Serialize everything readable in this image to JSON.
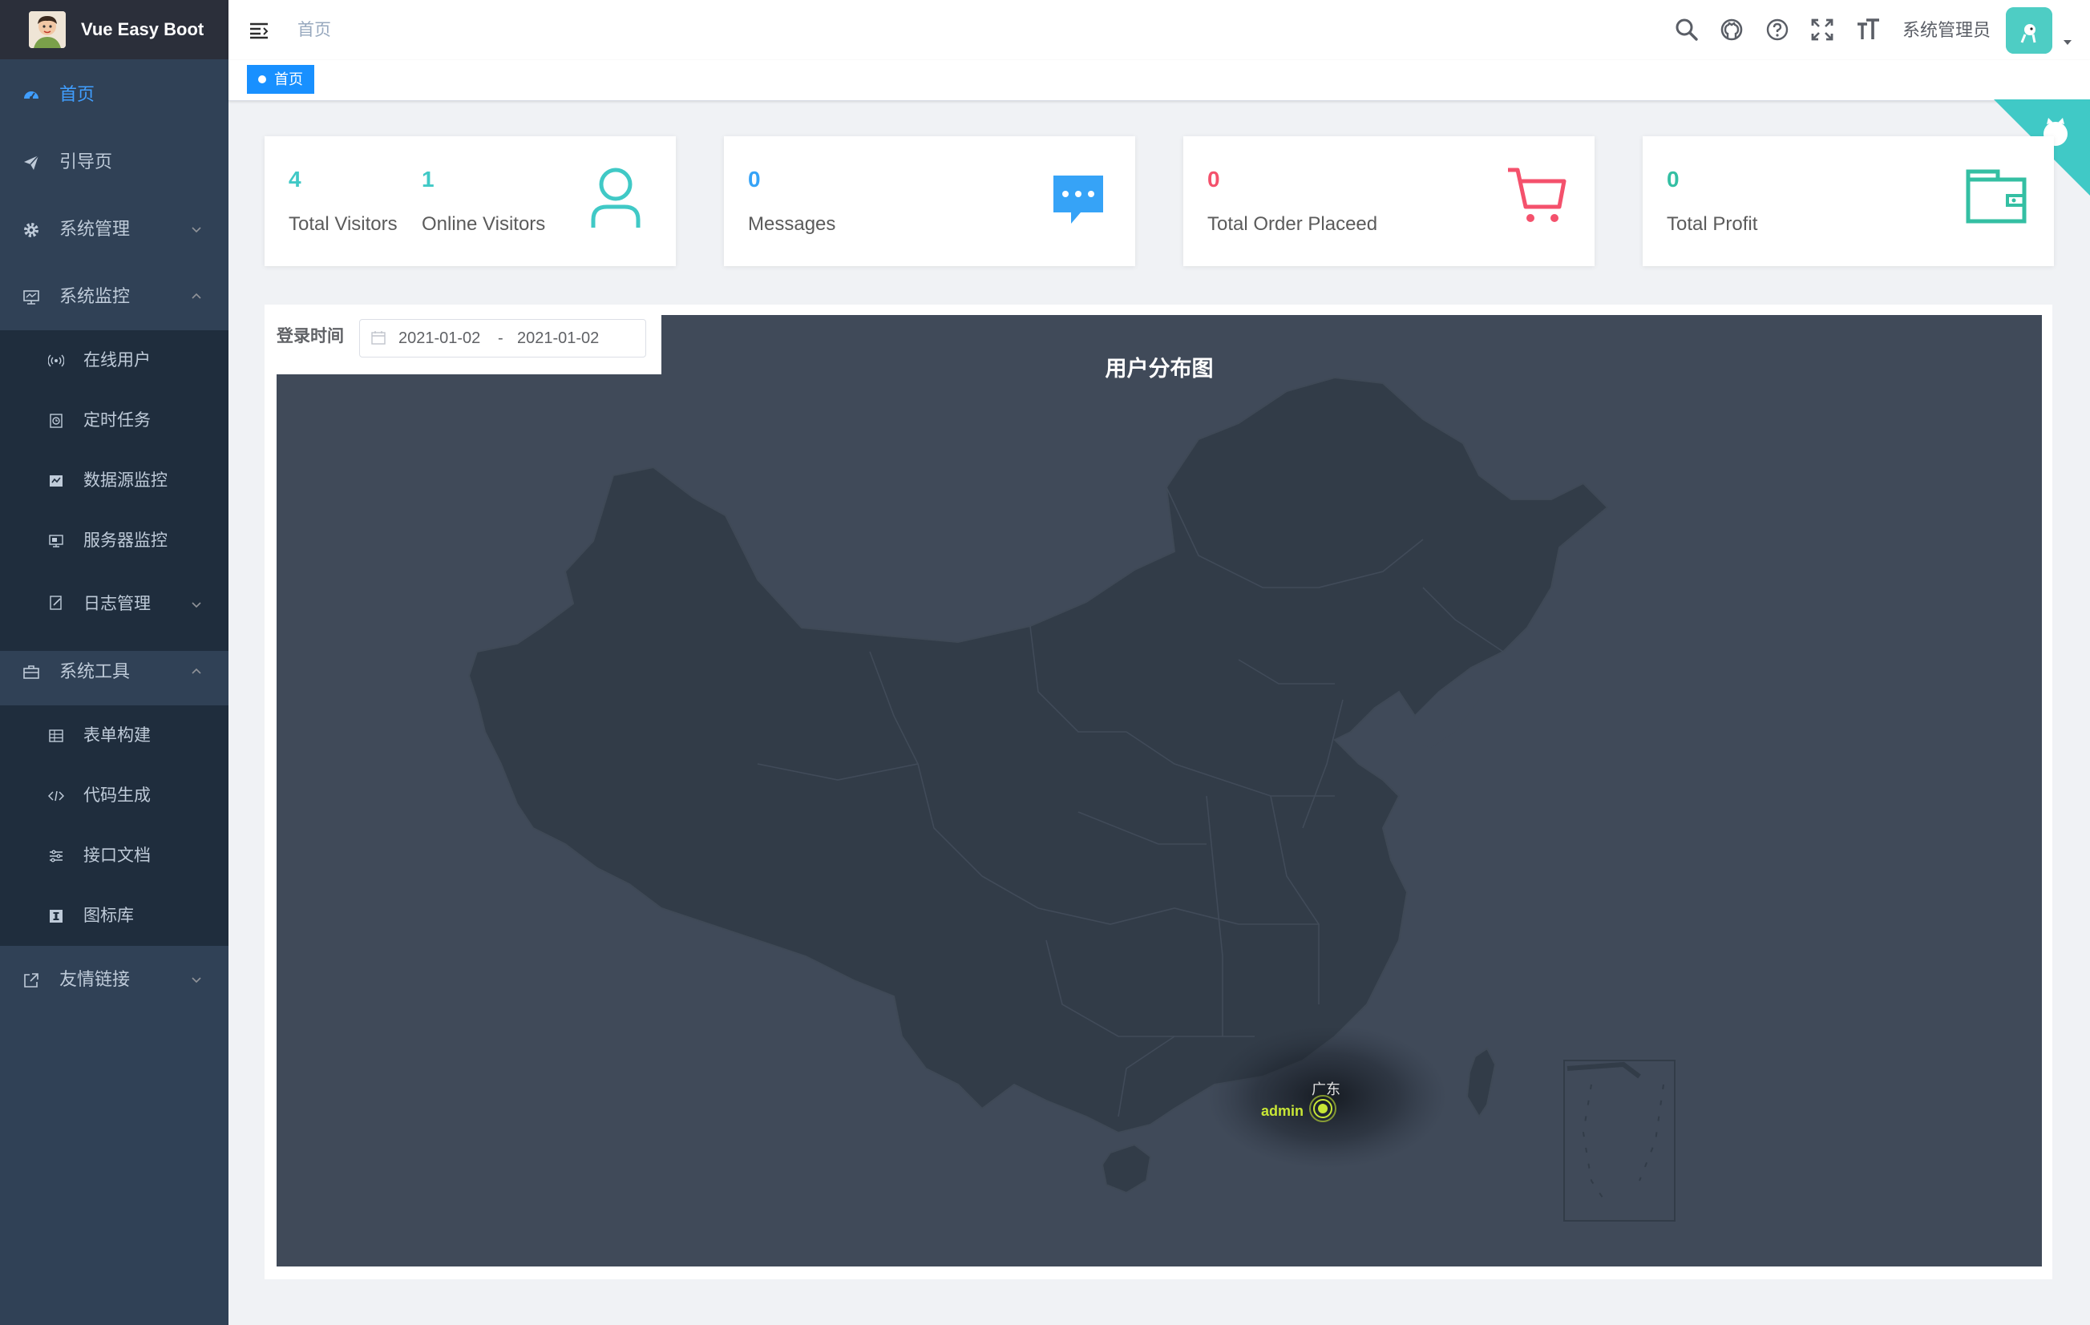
{
  "app": {
    "title": "Vue Easy Boot"
  },
  "sidebar": {
    "items": [
      {
        "label": "首页",
        "icon": "dashboard-icon",
        "active": true
      },
      {
        "label": "引导页",
        "icon": "paper-plane-icon"
      },
      {
        "label": "系统管理",
        "icon": "gear-icon",
        "expanded": false
      },
      {
        "label": "系统监控",
        "icon": "monitor-icon",
        "expanded": true,
        "children": [
          {
            "label": "在线用户",
            "icon": "online-icon"
          },
          {
            "label": "定时任务",
            "icon": "timer-icon"
          },
          {
            "label": "数据源监控",
            "icon": "datasource-icon"
          },
          {
            "label": "服务器监控",
            "icon": "server-icon"
          },
          {
            "label": "日志管理",
            "icon": "log-icon",
            "expanded": false
          }
        ]
      },
      {
        "label": "系统工具",
        "icon": "toolbox-icon",
        "expanded": true,
        "children": [
          {
            "label": "表单构建",
            "icon": "form-icon"
          },
          {
            "label": "代码生成",
            "icon": "code-icon"
          },
          {
            "label": "接口文档",
            "icon": "api-doc-icon"
          },
          {
            "label": "图标库",
            "icon": "icon-library-icon"
          }
        ]
      },
      {
        "label": "友情链接",
        "icon": "external-link-icon",
        "expanded": false
      }
    ]
  },
  "header": {
    "breadcrumb": "首页",
    "icons": [
      "search-icon",
      "github-icon",
      "help-icon",
      "fullscreen-icon",
      "font-size-icon"
    ],
    "user_name": "系统管理员"
  },
  "tags": [
    {
      "label": "首页",
      "active": true
    }
  ],
  "stats": {
    "total_visitors": {
      "value": "4",
      "label": "Total Visitors",
      "color": "#40c9c6"
    },
    "online_visitors": {
      "value": "1",
      "label": "Online Visitors",
      "color": "#40c9c6"
    },
    "messages": {
      "value": "0",
      "label": "Messages",
      "color": "#36a3f7"
    },
    "orders": {
      "value": "0",
      "label": "Total Order Placeed",
      "color": "#f4516c"
    },
    "profit": {
      "value": "0",
      "label": "Total Profit",
      "color": "#34bfa3"
    }
  },
  "filter": {
    "label": "登录时间",
    "start": "2021-01-02",
    "separator": "-",
    "end": "2021-01-02"
  },
  "map": {
    "title": "用户分布图",
    "points": [
      {
        "region": "广东",
        "user": "admin"
      }
    ]
  },
  "colors": {
    "sidebar_bg": "#304156",
    "active": "#409eff",
    "map_bg": "#404a59",
    "accent_green": "#c8e636"
  }
}
